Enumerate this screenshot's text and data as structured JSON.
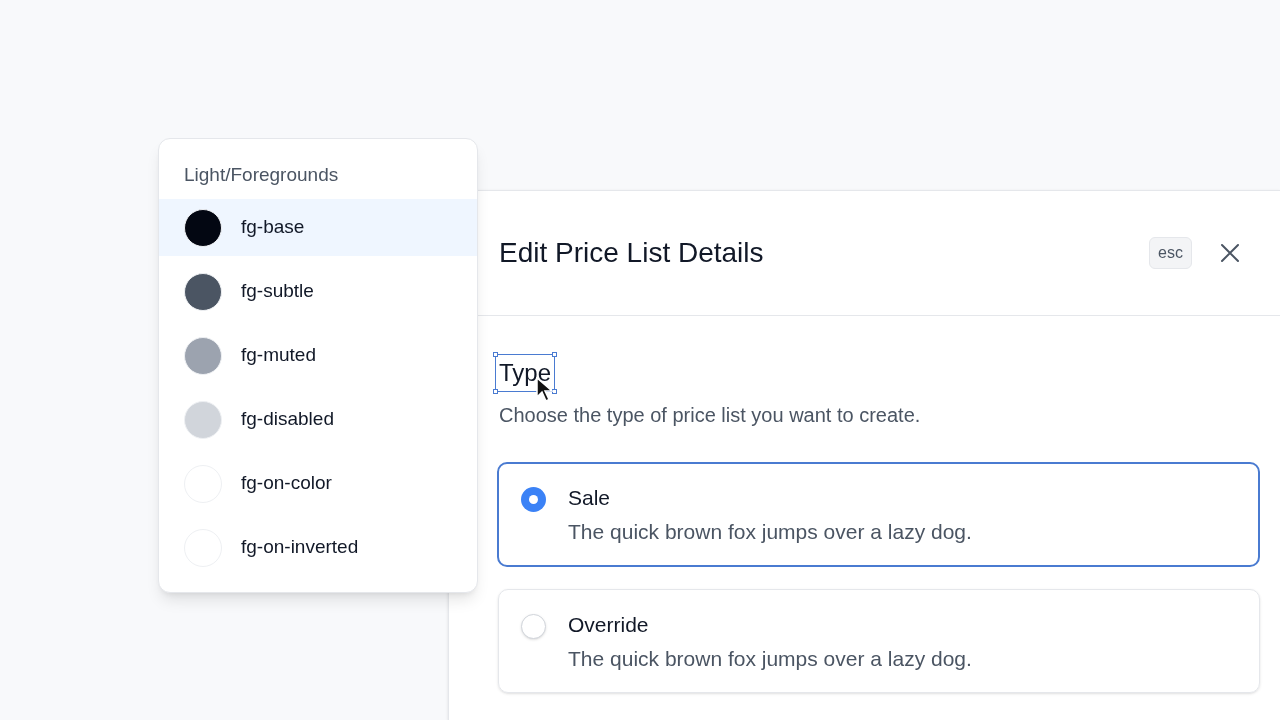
{
  "color_menu": {
    "heading": "Light/Foregrounds",
    "items": [
      {
        "label": "fg-base",
        "color": "#030712",
        "selected": true
      },
      {
        "label": "fg-subtle",
        "color": "#4b5563",
        "selected": false
      },
      {
        "label": "fg-muted",
        "color": "#9ca3af",
        "selected": false
      },
      {
        "label": "fg-disabled",
        "color": "#d1d5db",
        "selected": false
      },
      {
        "label": "fg-on-color",
        "color": "#ffffff",
        "selected": false
      },
      {
        "label": "fg-on-inverted",
        "color": "#ffffff",
        "selected": false
      }
    ]
  },
  "drawer": {
    "title": "Edit Price List Details",
    "esc_key": "esc",
    "section": {
      "label": "Type",
      "description": "Choose the type of price list you want to create."
    },
    "options": [
      {
        "title": "Sale",
        "description": "The quick brown fox jumps over a lazy dog.",
        "selected": true
      },
      {
        "title": "Override",
        "description": "The quick brown fox jumps over a lazy dog.",
        "selected": false
      }
    ]
  }
}
